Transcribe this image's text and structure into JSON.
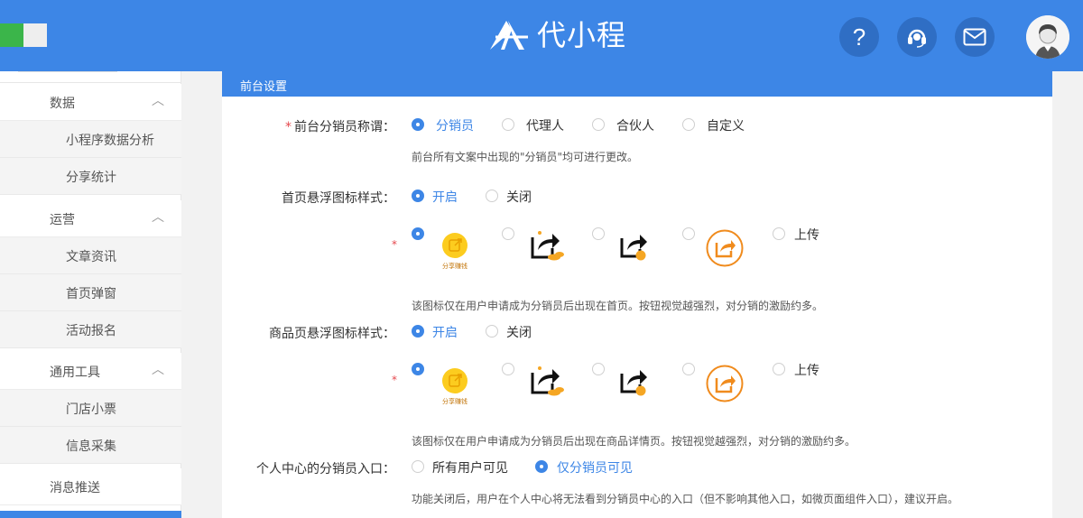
{
  "header": {
    "logo_text": "代小程",
    "help_icon": "question-mark-icon",
    "help_glyph": "?",
    "service_icon": "headset-icon",
    "mail_icon": "envelope-icon",
    "accent_color": "#3d86e6"
  },
  "sidebar": {
    "groups": [
      {
        "label": "数据",
        "chevron": "︿",
        "items": [
          {
            "label": "小程序数据分析"
          },
          {
            "label": "分享统计"
          }
        ]
      },
      {
        "label": "运营",
        "chevron": "︿",
        "items": [
          {
            "label": "文章资讯"
          },
          {
            "label": "首页弹窗"
          },
          {
            "label": "活动报名"
          }
        ]
      },
      {
        "label": "通用工具",
        "chevron": "︿",
        "items": [
          {
            "label": "门店小票"
          },
          {
            "label": "信息采集"
          }
        ]
      }
    ],
    "message_push": "消息推送"
  },
  "main": {
    "section_title": "前台设置",
    "distributor_name": {
      "label": "前台分销员称谓：",
      "options": [
        "分销员",
        "代理人",
        "合伙人",
        "自定义"
      ],
      "selected": 0,
      "hint": "前台所有文案中出现的\"分销员\"均可进行更改。"
    },
    "home_float": {
      "label": "首页悬浮图标样式：",
      "options": [
        "开启",
        "关闭"
      ],
      "selected": 0,
      "icon_caption": "分享赚钱",
      "upload_label": "上传",
      "hint": "该图标仅在用户申请成为分销员后出现在首页。按钮视觉越强烈，对分销的激励约多。"
    },
    "product_float": {
      "label": "商品页悬浮图标样式：",
      "options": [
        "开启",
        "关闭"
      ],
      "selected": 0,
      "icon_caption": "分享赚钱",
      "upload_label": "上传",
      "hint": "该图标仅在用户申请成为分销员后出现在商品详情页。按钮视觉越强烈，对分销的激励约多。"
    },
    "center_entry": {
      "label": "个人中心的分销员入口：",
      "options": [
        "所有用户可见",
        "仅分销员可见"
      ],
      "selected": 1,
      "hint": "功能关闭后，用户在个人中心将无法看到分销员中心的入口（但不影响其他入口，如微页面组件入口），建议开启。"
    }
  }
}
